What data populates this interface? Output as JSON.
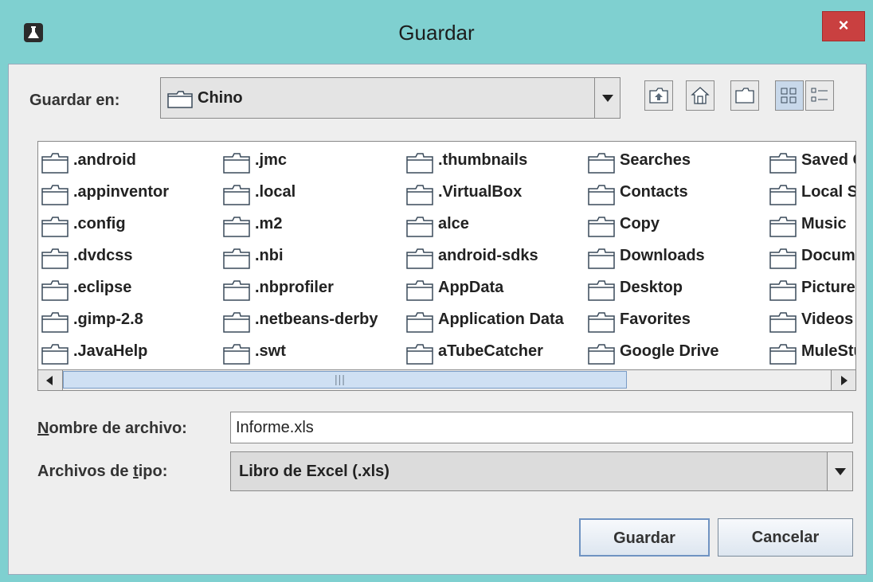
{
  "window": {
    "title": "Guardar",
    "close_glyph": "×"
  },
  "toolbar": {
    "save_in_label": "Guardar en:",
    "location": "Chino",
    "buttons": [
      "up-one-level-icon",
      "home-icon",
      "new-folder-icon",
      "list-view-icon",
      "details-view-icon"
    ]
  },
  "files": {
    "columns": [
      [
        ".android",
        ".appinventor",
        ".config",
        ".dvdcss",
        ".eclipse",
        ".gimp-2.8",
        ".JavaHelp"
      ],
      [
        ".jmc",
        ".local",
        ".m2",
        ".nbi",
        ".nbprofiler",
        ".netbeans-derby",
        ".swt"
      ],
      [
        ".thumbnails",
        ".VirtualBox",
        "alce",
        "android-sdks",
        "AppData",
        "Application Data",
        "aTubeCatcher"
      ],
      [
        "Searches",
        "Contacts",
        "Copy",
        "Downloads",
        "Desktop",
        "Favorites",
        "Google Drive"
      ],
      [
        "Saved Games",
        "Local Settings",
        "Music",
        "Documents",
        "Pictures",
        "Videos",
        "MuleStudio"
      ]
    ]
  },
  "form": {
    "filename_label_first": "N",
    "filename_label_rest": "ombre de archivo:",
    "filename_value": "Informe.xls",
    "filetype_label_before": "Archivos de ",
    "filetype_label_mnemonic": "t",
    "filetype_label_after": "ipo:",
    "filetype_value": "Libro de Excel (.xls)"
  },
  "actions": {
    "save_label": "Guardar",
    "cancel_label": "Cancelar"
  },
  "colors": {
    "frame": "#7fd0d0",
    "close": "#c94040",
    "panel": "#eeeeee"
  }
}
